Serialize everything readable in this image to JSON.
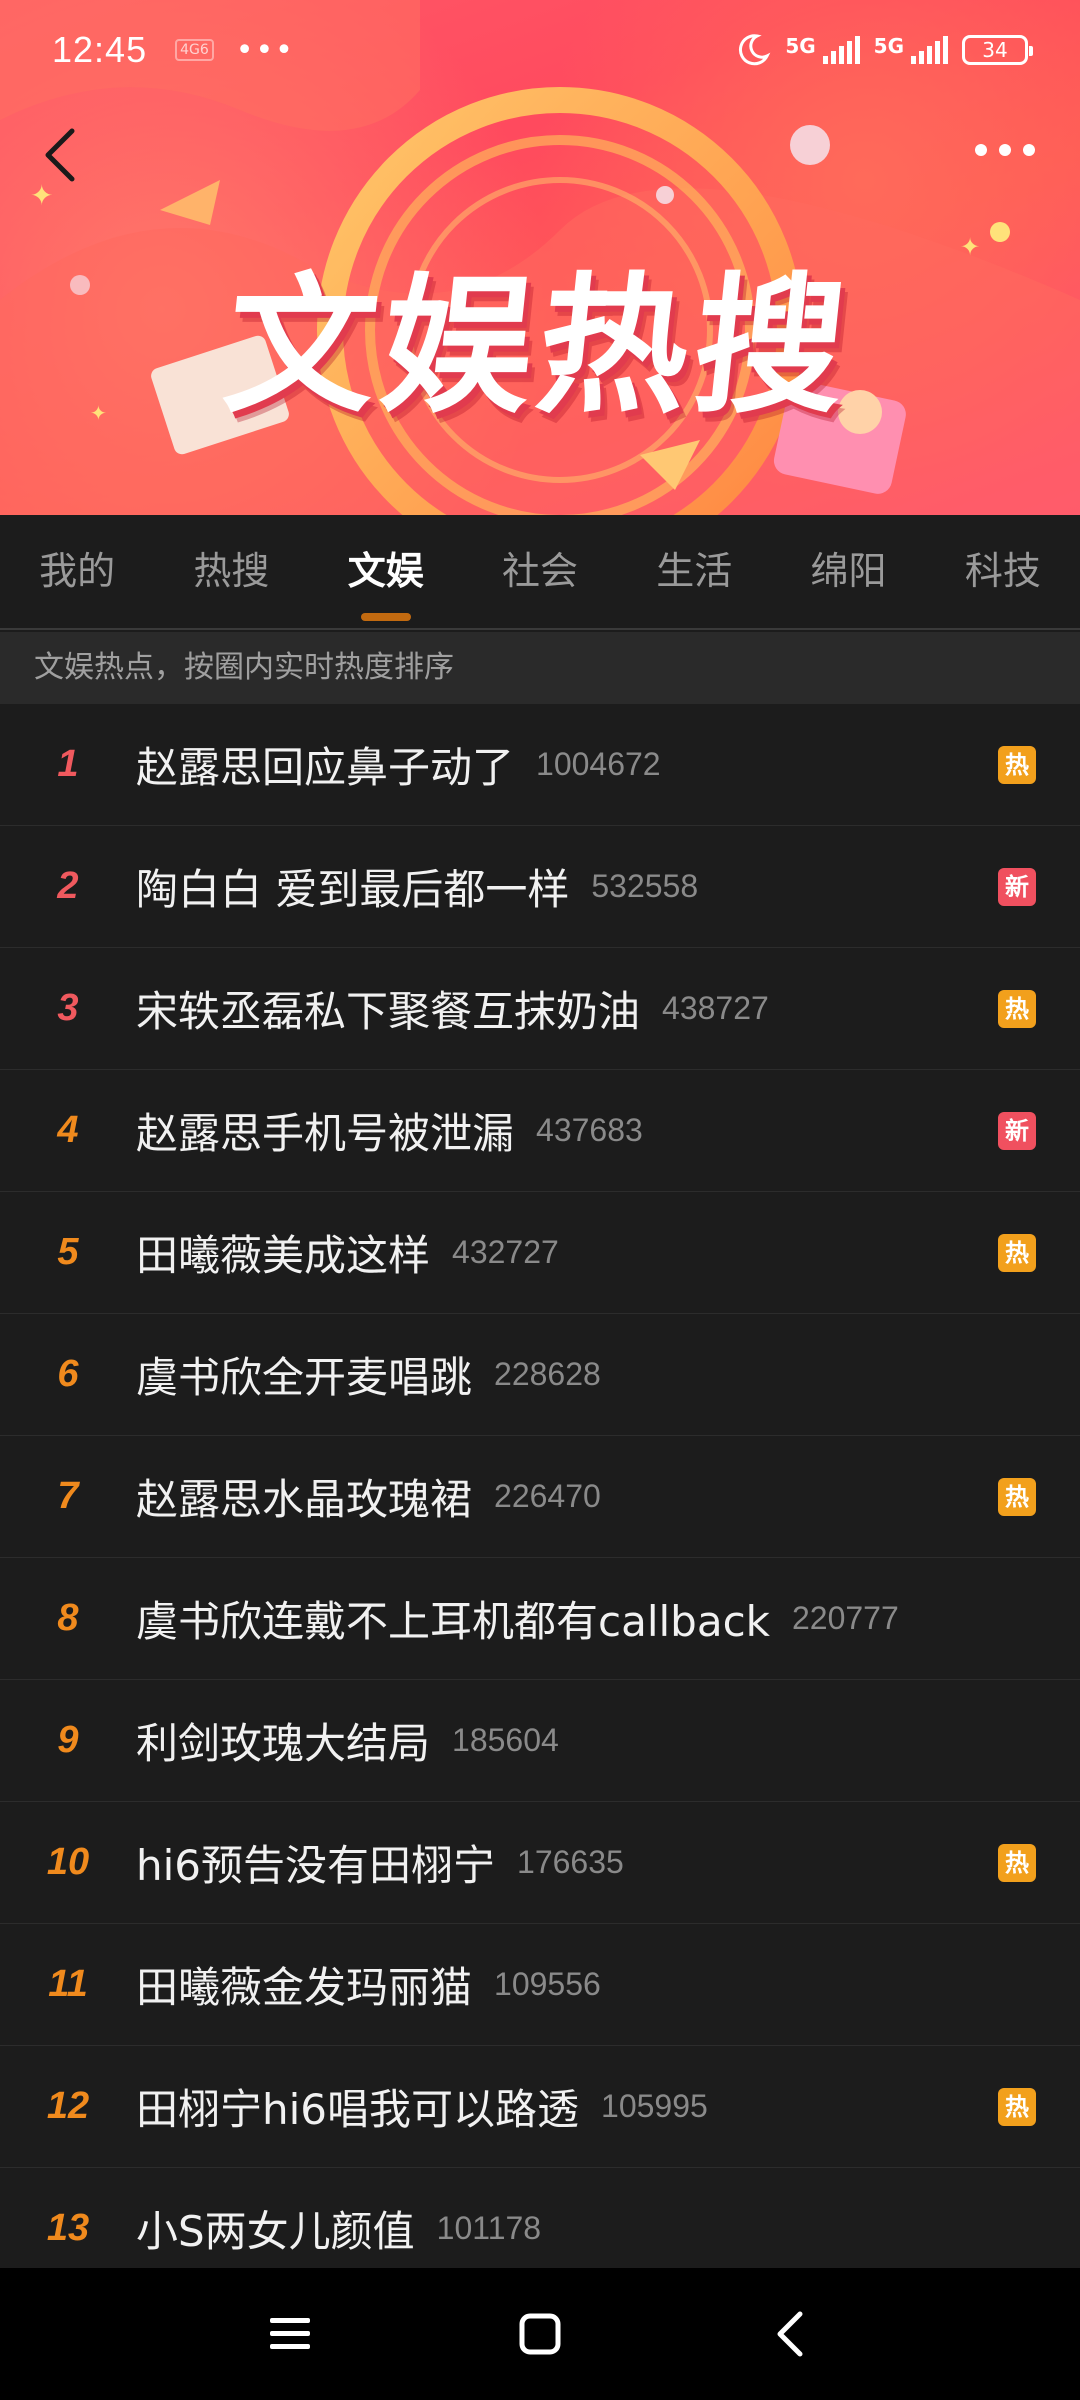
{
  "status_bar": {
    "time": "12:45",
    "mini_icon": "4G6",
    "dots": "•••",
    "sig1": "5G",
    "sig2": "5G",
    "battery": "34"
  },
  "banner": {
    "title": "文娱热搜"
  },
  "tabs": [
    {
      "label": "我的",
      "active": false
    },
    {
      "label": "热搜",
      "active": false
    },
    {
      "label": "文娱",
      "active": true
    },
    {
      "label": "社会",
      "active": false
    },
    {
      "label": "生活",
      "active": false
    },
    {
      "label": "绵阳",
      "active": false
    },
    {
      "label": "科技",
      "active": false
    }
  ],
  "subheader": "文娱热点，按圈内实时热度排序",
  "colors": {
    "hot_badge": "#f2a01c",
    "new_badge": "#f0505f",
    "rank_top": "#f0595e",
    "rank_normal": "#f08a1d",
    "tab_indicator": "#c26a10"
  },
  "items": [
    {
      "rank": "1",
      "title": "赵露思回应鼻子动了",
      "count": "1004672",
      "badge": "热"
    },
    {
      "rank": "2",
      "title": "陶白白 爱到最后都一样",
      "count": "532558",
      "badge": "新"
    },
    {
      "rank": "3",
      "title": "宋轶丞磊私下聚餐互抹奶油",
      "count": "438727",
      "badge": "热"
    },
    {
      "rank": "4",
      "title": "赵露思手机号被泄漏",
      "count": "437683",
      "badge": "新"
    },
    {
      "rank": "5",
      "title": "田曦薇美成这样",
      "count": "432727",
      "badge": "热"
    },
    {
      "rank": "6",
      "title": "虞书欣全开麦唱跳",
      "count": "228628",
      "badge": ""
    },
    {
      "rank": "7",
      "title": "赵露思水晶玫瑰裙",
      "count": "226470",
      "badge": "热"
    },
    {
      "rank": "8",
      "title": "虞书欣连戴不上耳机都有callback",
      "count": "220777",
      "badge": ""
    },
    {
      "rank": "9",
      "title": "利剑玫瑰大结局",
      "count": "185604",
      "badge": ""
    },
    {
      "rank": "10",
      "title": "hi6预告没有田栩宁",
      "count": "176635",
      "badge": "热"
    },
    {
      "rank": "11",
      "title": "田曦薇金发玛丽猫",
      "count": "109556",
      "badge": ""
    },
    {
      "rank": "12",
      "title": "田栩宁hi6唱我可以路透",
      "count": "105995",
      "badge": "热"
    },
    {
      "rank": "13",
      "title": "小S两女儿颜值",
      "count": "101178",
      "badge": ""
    }
  ],
  "icons": {
    "back": "chevron-left-icon",
    "more": "more-dots-icon",
    "nav_menu": "menu-icon",
    "nav_home": "home-square-icon",
    "nav_back": "back-triangle-icon"
  }
}
